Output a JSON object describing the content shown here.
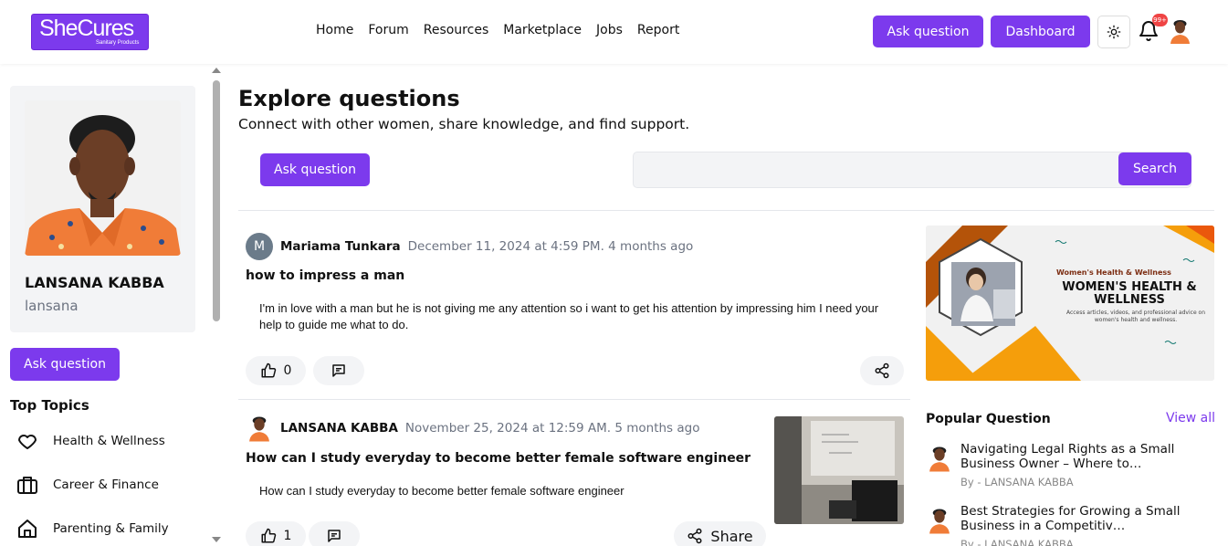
{
  "header": {
    "logo_text": "SheCures",
    "logo_sub": "Sanitary Products",
    "nav": [
      "Home",
      "Forum",
      "Resources",
      "Marketplace",
      "Jobs",
      "Report"
    ],
    "ask_label": "Ask question",
    "dashboard_label": "Dashboard",
    "notification_count": "99+"
  },
  "sidebar": {
    "profile_name": "LANSANA KABBA",
    "profile_username": "lansana",
    "ask_label": "Ask question",
    "topics_title": "Top Topics",
    "topics": [
      {
        "label": "Health & Wellness",
        "icon": "heart-icon"
      },
      {
        "label": "Career & Finance",
        "icon": "briefcase-icon"
      },
      {
        "label": "Parenting & Family",
        "icon": "home-icon"
      }
    ]
  },
  "main": {
    "title": "Explore questions",
    "subtitle": "Connect with other women, share knowledge, and find support.",
    "ask_label": "Ask question",
    "search_placeholder": "",
    "search_label": "Search",
    "posts": [
      {
        "avatar_letter": "M",
        "author": "Mariama Tunkara",
        "date": "December 11, 2024 at 4:59 PM. 4 months ago",
        "title": "how to impress a man",
        "body": "I'm in love with a man but he is not giving me any attention so i want to get his attention by impressing him I need your help to guide me what to do.",
        "likes": "0"
      },
      {
        "author": "LANSANA KABBA",
        "date": "November 25, 2024 at 12:59 AM. 5 months ago",
        "title": "How can I study everyday to become better female software engineer",
        "body": "How can I study everyday to become better female software engineer",
        "likes": "1",
        "share_label": "Share"
      }
    ]
  },
  "right": {
    "banner_small": "Women's Health & Wellness",
    "banner_big": "WOMEN'S HEALTH & WELLNESS",
    "banner_desc": "Access articles, videos, and professional advice on women's health and wellness.",
    "popular_title": "Popular Question",
    "view_all": "View all",
    "popular": [
      {
        "title": "Navigating Legal Rights as a Small Business Owner – Where to…",
        "by": "By - LANSANA KABBA"
      },
      {
        "title": "Best Strategies for Growing a Small Business in a Competitiv…",
        "by": "By - LANSANA KABBA"
      }
    ]
  },
  "colors": {
    "accent": "#7c3aed",
    "badge": "#ef4444",
    "muted": "#6b7280"
  }
}
